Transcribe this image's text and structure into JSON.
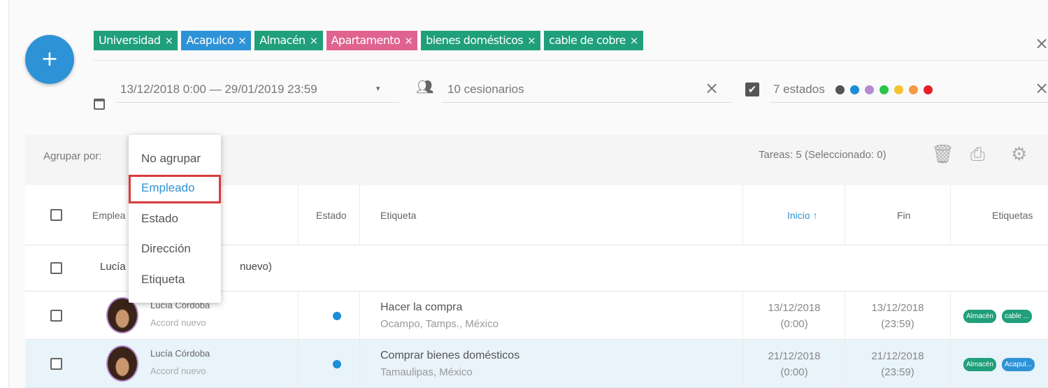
{
  "add_button": {
    "label": "+"
  },
  "filter_tags": [
    {
      "label": "Universidad",
      "color": "#1f9f7a"
    },
    {
      "label": "Acapulco",
      "color": "#2e93d6"
    },
    {
      "label": "Almacén",
      "color": "#1f9f7a"
    },
    {
      "label": "Apartamento",
      "color": "#e0638f"
    },
    {
      "label": "bienes domésticos",
      "color": "#1f9f7a"
    },
    {
      "label": "cable de cobre",
      "color": "#1f9f7a"
    }
  ],
  "tag_remove_glyph": "×",
  "clear_glyph": "×",
  "date_filter": {
    "value": "13/12/2018 0:00 — 29/01/2019 23:59",
    "caret": "▾",
    "icon": "calendar-icon"
  },
  "assignee_filter": {
    "value": "10 cesionarios",
    "icon": "people-icon"
  },
  "status_filter": {
    "checkbox": "✔",
    "value": "7 estados",
    "dot_colors": [
      "#555555",
      "#1a8ed6",
      "#b58ad1",
      "#2cc34a",
      "#f4c430",
      "#f49b42",
      "#e8202a"
    ]
  },
  "toolbar": {
    "group_by_label": "Agrupar por:",
    "tasks_count": "Tareas: 5 (Seleccionado: 0)",
    "icons": [
      "trash-icon",
      "print-icon",
      "gear-icon"
    ]
  },
  "group_menu": {
    "options": [
      "No agrupar",
      "Empleado",
      "Estado",
      "Dirección",
      "Etiqueta"
    ],
    "selected": "Empleado"
  },
  "table": {
    "headers": {
      "employee": "Emplea",
      "state": "Estado",
      "label": "Etiqueta",
      "start": "Inicio ↑",
      "end": "Fin",
      "tags": "Etiquetas"
    },
    "group_row": {
      "title_left": "Lucía C",
      "title_right": "nuevo)"
    },
    "rows": [
      {
        "employee": "Lucía Córdoba",
        "employee_sub": "Accord nuevo",
        "state_color": "#1a8ed6",
        "title": "Hacer la compra",
        "address": "Ocampo, Tamps., México",
        "start_date": "13/12/2018",
        "start_time": "(0:00)",
        "end_date": "13/12/2018",
        "end_time": "(23:59)",
        "tags": [
          {
            "label": "Almacén",
            "color": "#1f9f7a"
          },
          {
            "label": "cable ...",
            "color": "#1f9f7a"
          }
        ]
      },
      {
        "employee": "Lucía Córdoba",
        "employee_sub": "Accord nuevo",
        "state_color": "#1a8ed6",
        "title": "Comprar bienes domésticos",
        "address": "Tamaulipas, México",
        "start_date": "21/12/2018",
        "start_time": "(0:00)",
        "end_date": "21/12/2018",
        "end_time": "(23:59)",
        "tags": [
          {
            "label": "Almacén",
            "color": "#1f9f7a"
          },
          {
            "label": "Acapul...",
            "color": "#2e93d6"
          }
        ]
      }
    ]
  }
}
